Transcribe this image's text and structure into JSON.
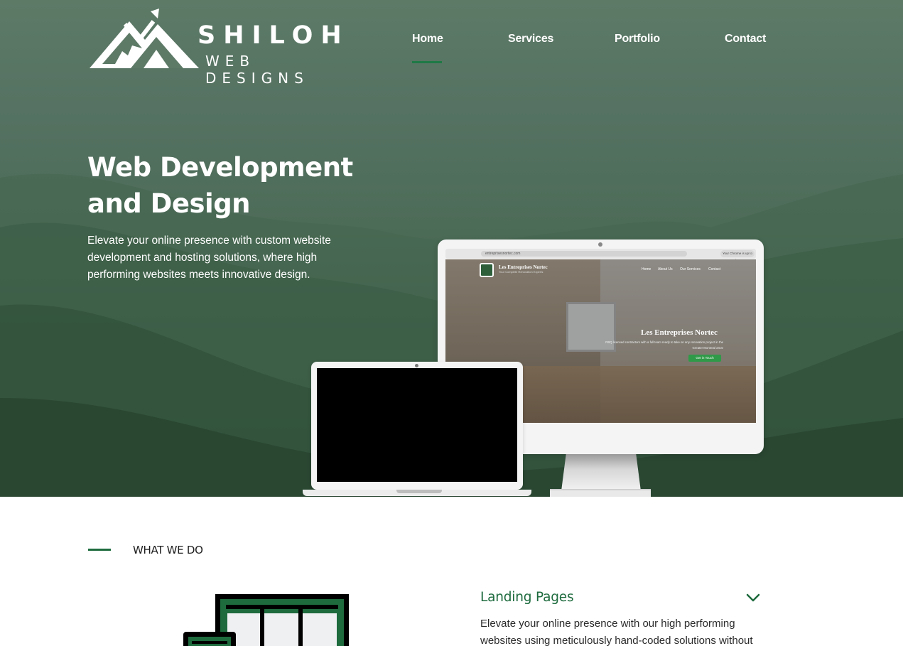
{
  "brand": {
    "title": "SHILOH",
    "subtitle": "WEB DESIGNS"
  },
  "nav": {
    "items": [
      "Home",
      "Services",
      "Portfolio",
      "Contact"
    ],
    "active": "Home",
    "accent_color": "#1e7a45"
  },
  "hero": {
    "title": "Web Development and Design",
    "text": "Elevate your online presence with custom website development and hosting solutions, where high performing websites meets innovative design."
  },
  "mockup": {
    "url": "entreprisesnortec.com",
    "browser_pill": "Your Chrome is up to date",
    "site_name": "Les Entreprises Nortec",
    "site_tagline": "Your Complete Renovation Experts",
    "site_nav": [
      "Home",
      "About Us",
      "Our Services",
      "Contact"
    ],
    "hero_title": "Les Entreprises Nortec",
    "hero_text": "RBQ licensed contractors with a full team ready to take on any renovation project in the Greater Montreal area!",
    "cta": "Get in Touch"
  },
  "what_we_do": {
    "label": "WHAT WE DO",
    "item_title": "Landing Pages",
    "item_text": "Elevate your online presence with our high performing websites using meticulously hand-coded solutions without",
    "accent_color": "#1e6b3e",
    "chevron_icon": "chevron-down-icon"
  }
}
